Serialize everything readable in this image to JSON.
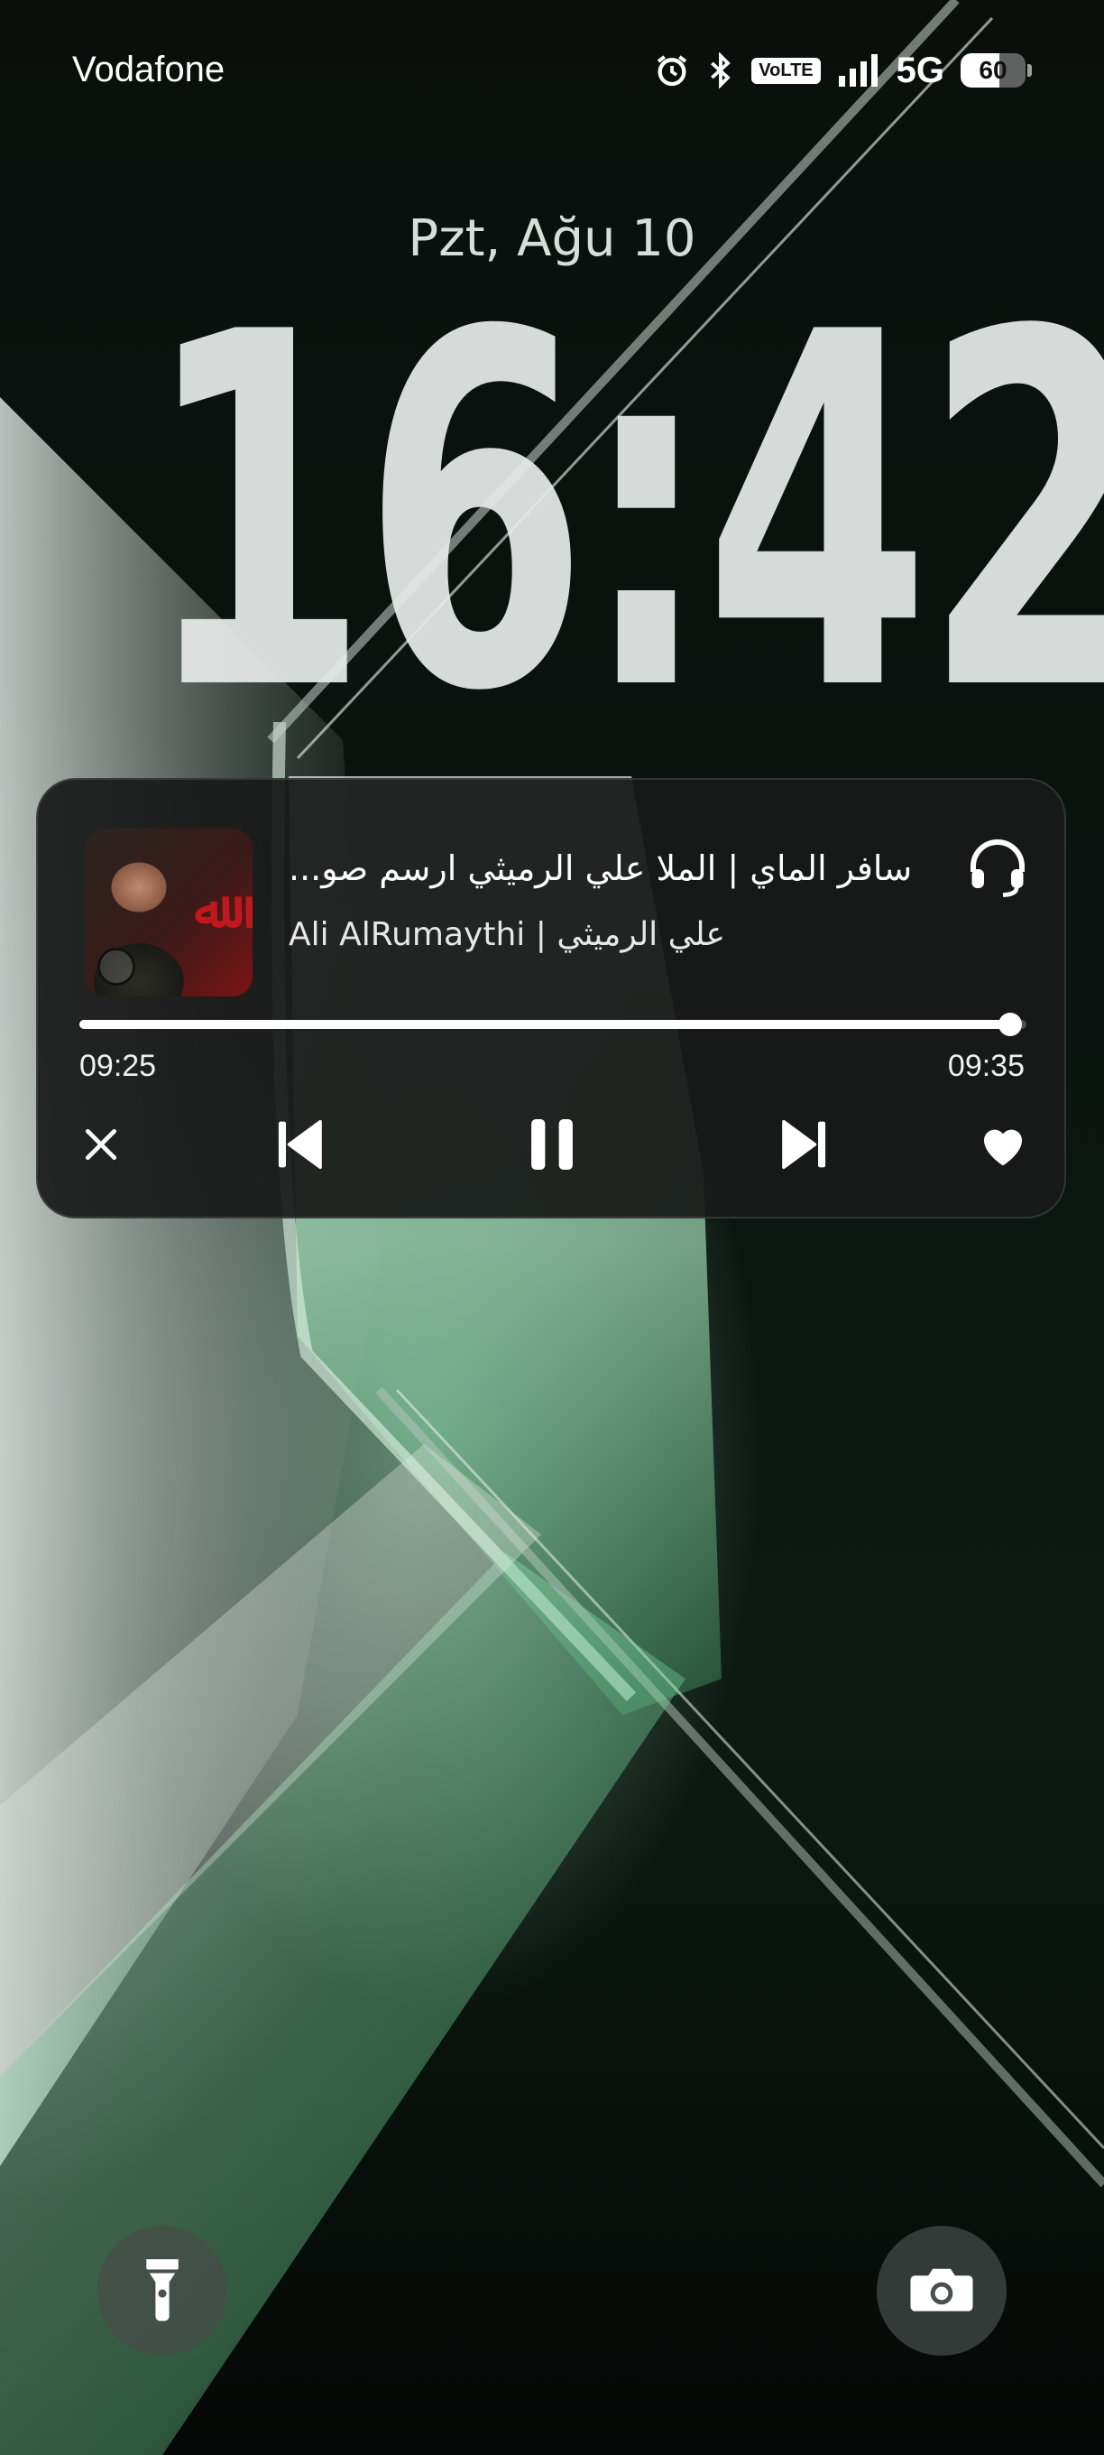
{
  "status_bar": {
    "carrier": "Vodafone",
    "volte": "VoLTE",
    "network": "5G",
    "battery_level": "60",
    "icons": [
      "alarm-icon",
      "bluetooth-icon",
      "volte-icon",
      "signal-icon",
      "battery-icon"
    ]
  },
  "lockscreen": {
    "date": "Pzt, Ağu 10",
    "time": "16:42"
  },
  "media": {
    "title": "سافر الماي | الملا علي الرميثي  ارسم صو...",
    "artist": "Ali AlRumaythi | علي الرميثي",
    "elapsed": "09:25",
    "total": "09:35",
    "progress_fraction": 0.983,
    "output_icon": "headphones-icon",
    "controls": [
      "close-icon",
      "previous-icon",
      "pause-icon",
      "next-icon",
      "heart-icon"
    ]
  },
  "shortcuts": {
    "left_icon": "flashlight-icon",
    "right_icon": "camera-icon"
  },
  "colors": {
    "card_bg": "#181a19",
    "accent_green": "#9be3b4",
    "text": "#ffffff"
  }
}
